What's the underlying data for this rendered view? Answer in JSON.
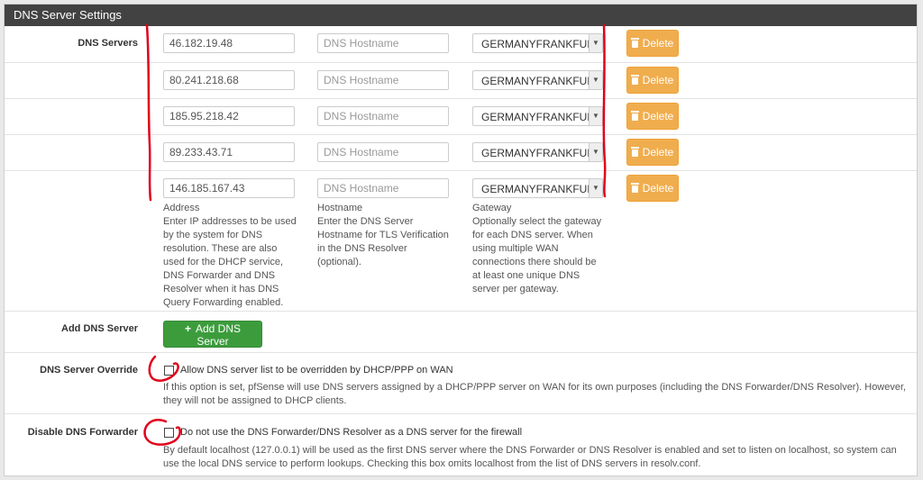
{
  "panel": {
    "title": "DNS Server Settings"
  },
  "dns_servers": {
    "label": "DNS Servers",
    "hostname_placeholder": "DNS Hostname",
    "delete_label": "Delete",
    "rows": [
      {
        "address": "46.182.19.48",
        "gateway": "GERMANYFRANKFURT"
      },
      {
        "address": "80.241.218.68",
        "gateway": "GERMANYFRANKFURT"
      },
      {
        "address": "185.95.218.42",
        "gateway": "GERMANYFRANKFURT"
      },
      {
        "address": "89.233.43.71",
        "gateway": "GERMANYFRANKFURT"
      },
      {
        "address": "146.185.167.43",
        "gateway": "GERMANYFRANKFURT"
      }
    ],
    "help": {
      "address_title": "Address",
      "address_text": "Enter IP addresses to be used by the system for DNS resolution. These are also used for the DHCP service, DNS Forwarder and DNS Resolver when it has DNS Query Forwarding enabled.",
      "hostname_title": "Hostname",
      "hostname_text": "Enter the DNS Server Hostname for TLS Verification in the DNS Resolver (optional).",
      "gateway_title": "Gateway",
      "gateway_text": "Optionally select the gateway for each DNS server. When using multiple WAN connections there should be at least one unique DNS server per gateway."
    }
  },
  "add_dns": {
    "label": "Add DNS Server",
    "button": "Add DNS Server"
  },
  "override": {
    "label": "DNS Server Override",
    "checkbox_label": "Allow DNS server list to be overridden by DHCP/PPP on WAN",
    "description": "If this option is set, pfSense will use DNS servers assigned by a DHCP/PPP server on WAN for its own purposes (including the DNS Forwarder/DNS Resolver). However, they will not be assigned to DHCP clients."
  },
  "disable_forwarder": {
    "label": "Disable DNS Forwarder",
    "checkbox_label": "Do not use the DNS Forwarder/DNS Resolver as a DNS server for the firewall",
    "description": "By default localhost (127.0.0.1) will be used as the first DNS server where the DNS Forwarder or DNS Resolver is enabled and set to listen on localhost, so system can use the local DNS service to perform lookups. Checking this box omits localhost from the list of DNS servers in resolv.conf."
  },
  "colors": {
    "annotation": "#e0001b",
    "delete": "#f0ad4e",
    "add": "#3c9c3c",
    "heading": "#424242"
  }
}
